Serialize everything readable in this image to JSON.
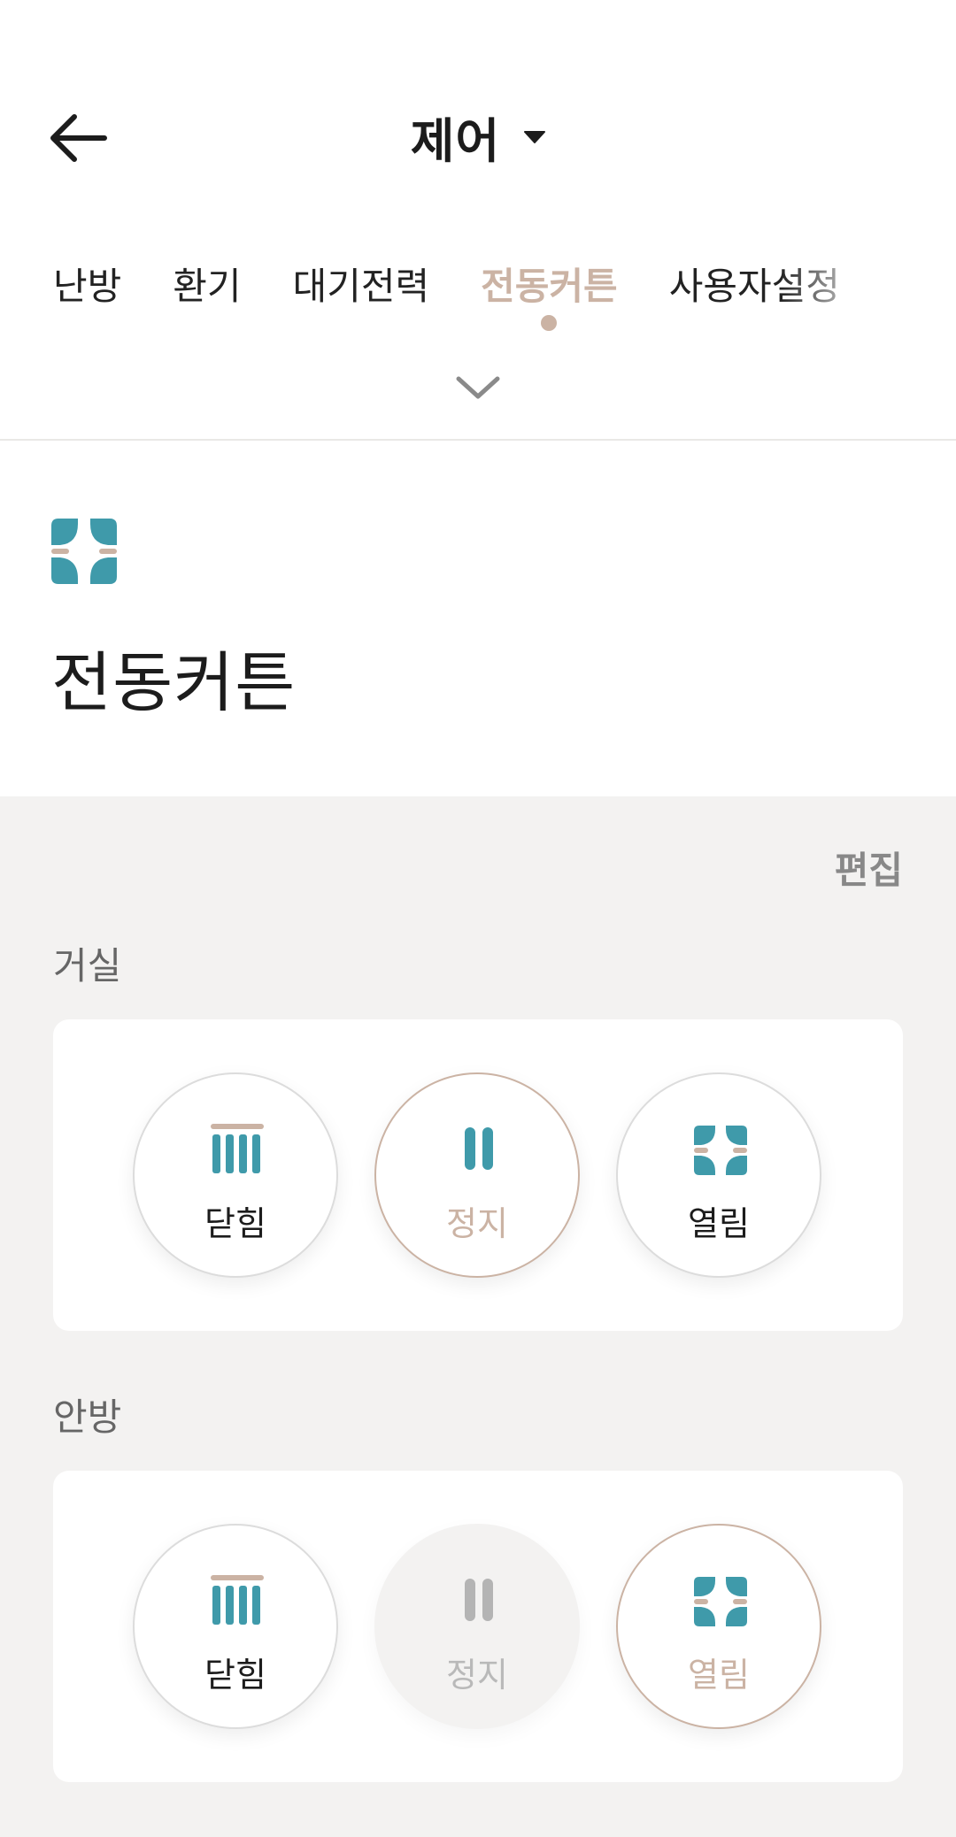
{
  "header": {
    "title": "제어"
  },
  "tabs": [
    {
      "label": "난방",
      "active": false
    },
    {
      "label": "환기",
      "active": false
    },
    {
      "label": "대기전력",
      "active": false
    },
    {
      "label": "전동커튼",
      "active": true
    },
    {
      "label": "사용자설정",
      "active": false
    }
  ],
  "category": {
    "title": "전동커튼",
    "icon": "curtain-open-icon"
  },
  "edit_label": "편집",
  "rooms": [
    {
      "name": "거실",
      "buttons": [
        {
          "label": "닫힘",
          "icon": "curtain-closed-icon",
          "state": "normal"
        },
        {
          "label": "정지",
          "icon": "pause-icon",
          "state": "selected"
        },
        {
          "label": "열림",
          "icon": "curtain-open-icon",
          "state": "normal"
        }
      ]
    },
    {
      "name": "안방",
      "buttons": [
        {
          "label": "닫힘",
          "icon": "curtain-closed-icon",
          "state": "normal"
        },
        {
          "label": "정지",
          "icon": "pause-icon",
          "state": "disabled"
        },
        {
          "label": "열림",
          "icon": "curtain-open-icon",
          "state": "selected"
        }
      ]
    }
  ],
  "colors": {
    "accent": "#cbb3a4",
    "teal": "#3f9aaa",
    "background": "#f3f2f1"
  }
}
